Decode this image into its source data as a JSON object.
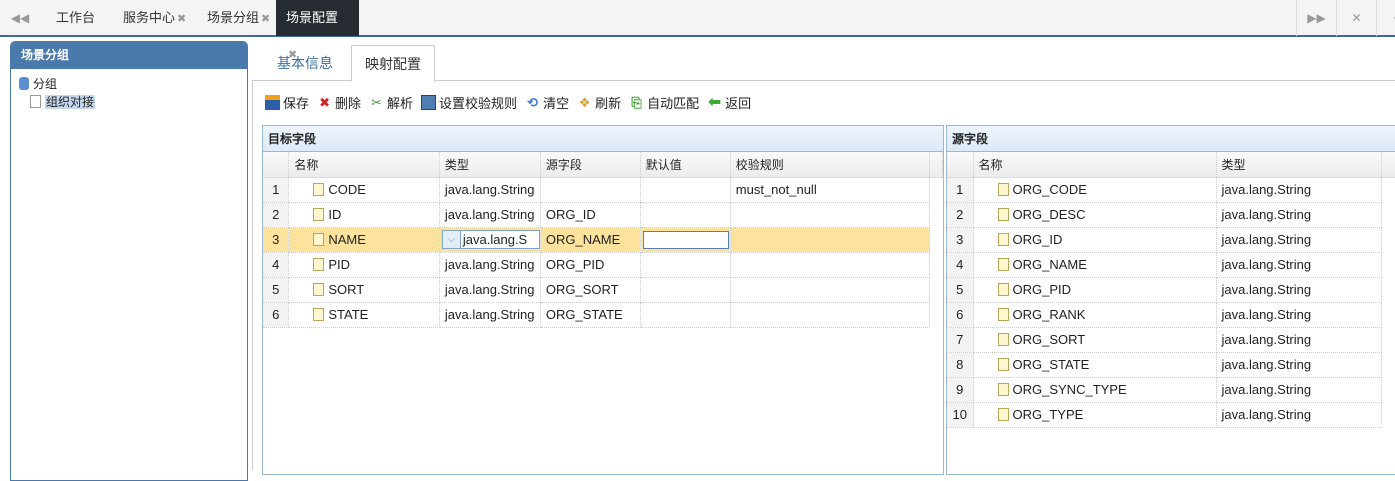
{
  "topbar": {
    "tabs": [
      {
        "label": "工作台",
        "closable": false
      },
      {
        "label": "服务中心",
        "closable": true
      },
      {
        "label": "场景分组",
        "closable": true
      },
      {
        "label": "场景配置",
        "closable": true,
        "active": true
      }
    ],
    "close_glyph": "✖"
  },
  "left_panel": {
    "title": "场景分组",
    "tree": {
      "root": "分组",
      "child": "组织对接"
    }
  },
  "panel_tabs": [
    {
      "label": "基本信息"
    },
    {
      "label": "映射配置",
      "active": true
    }
  ],
  "toolbar": [
    {
      "label": "保存",
      "icon": "save-icon"
    },
    {
      "label": "删除",
      "icon": "delete-icon"
    },
    {
      "label": "解析",
      "icon": "parse-icon"
    },
    {
      "label": "设置校验规则",
      "icon": "rule-icon"
    },
    {
      "label": "清空",
      "icon": "clear-icon"
    },
    {
      "label": "刷新",
      "icon": "refresh-icon"
    },
    {
      "label": "自动匹配",
      "icon": "auto-match-icon"
    },
    {
      "label": "返回",
      "icon": "back-icon"
    }
  ],
  "target_grid": {
    "title": "目标字段",
    "columns": [
      "名称",
      "类型",
      "源字段",
      "默认值",
      "校验规则"
    ],
    "rows": [
      [
        "1",
        "CODE",
        "java.lang.String",
        "",
        "",
        "must_not_null"
      ],
      [
        "2",
        "ID",
        "java.lang.String",
        "ORG_ID",
        "",
        ""
      ],
      [
        "3",
        "NAME",
        "java.lang.S",
        "ORG_NAME",
        "",
        ""
      ],
      [
        "4",
        "PID",
        "java.lang.String",
        "ORG_PID",
        "",
        ""
      ],
      [
        "5",
        "SORT",
        "java.lang.String",
        "ORG_SORT",
        "",
        ""
      ],
      [
        "6",
        "STATE",
        "java.lang.String",
        "ORG_STATE",
        "",
        ""
      ]
    ],
    "editing_row": 3
  },
  "source_grid": {
    "title": "源字段",
    "columns": [
      "名称",
      "类型"
    ],
    "rows": [
      [
        "1",
        "ORG_CODE",
        "java.lang.String"
      ],
      [
        "2",
        "ORG_DESC",
        "java.lang.String"
      ],
      [
        "3",
        "ORG_ID",
        "java.lang.String"
      ],
      [
        "4",
        "ORG_NAME",
        "java.lang.String"
      ],
      [
        "5",
        "ORG_PID",
        "java.lang.String"
      ],
      [
        "6",
        "ORG_RANK",
        "java.lang.String"
      ],
      [
        "7",
        "ORG_SORT",
        "java.lang.String"
      ],
      [
        "8",
        "ORG_STATE",
        "java.lang.String"
      ],
      [
        "9",
        "ORG_SYNC_TYPE",
        "java.lang.String"
      ],
      [
        "10",
        "ORG_TYPE",
        "java.lang.String"
      ]
    ]
  },
  "colors": {
    "accent": "#4a79ab",
    "highlight": "#fbe29d",
    "active_tab": "#252b31"
  }
}
